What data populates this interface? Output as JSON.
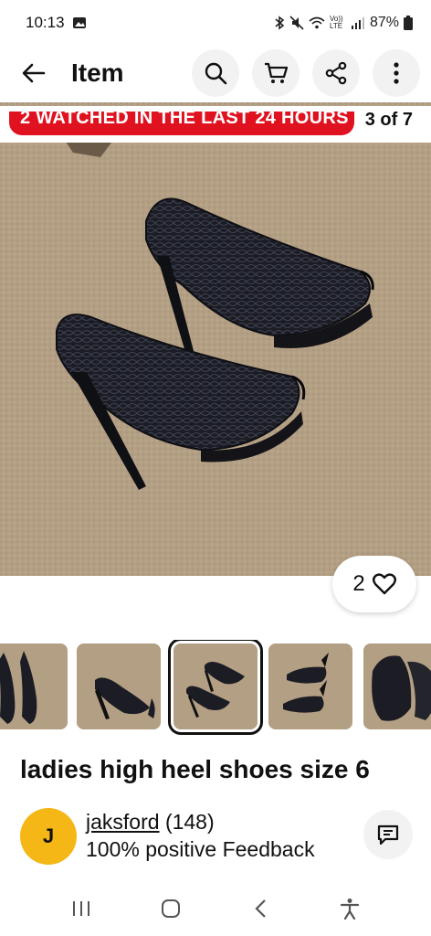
{
  "status_bar": {
    "time": "10:13",
    "network_label": "Vo)) LTE",
    "battery": "87%"
  },
  "header": {
    "title": "Item",
    "icons": [
      "back-arrow-icon",
      "search-icon",
      "cart-icon",
      "share-icon",
      "more-icon"
    ]
  },
  "gallery": {
    "banner": "2 WATCHED IN THE LAST 24 HOURS",
    "counter": "3 of 7",
    "watch_count": "2",
    "selected_index": 2
  },
  "item": {
    "title": "ladies high heel shoes size 6"
  },
  "seller": {
    "initial": "J",
    "name": "jaksford",
    "score": "(148)",
    "feedback": "100% positive Feedback"
  },
  "colors": {
    "banner_red": "#e0121f",
    "avatar_yellow": "#f5b715",
    "carpet": "#b39f84"
  }
}
